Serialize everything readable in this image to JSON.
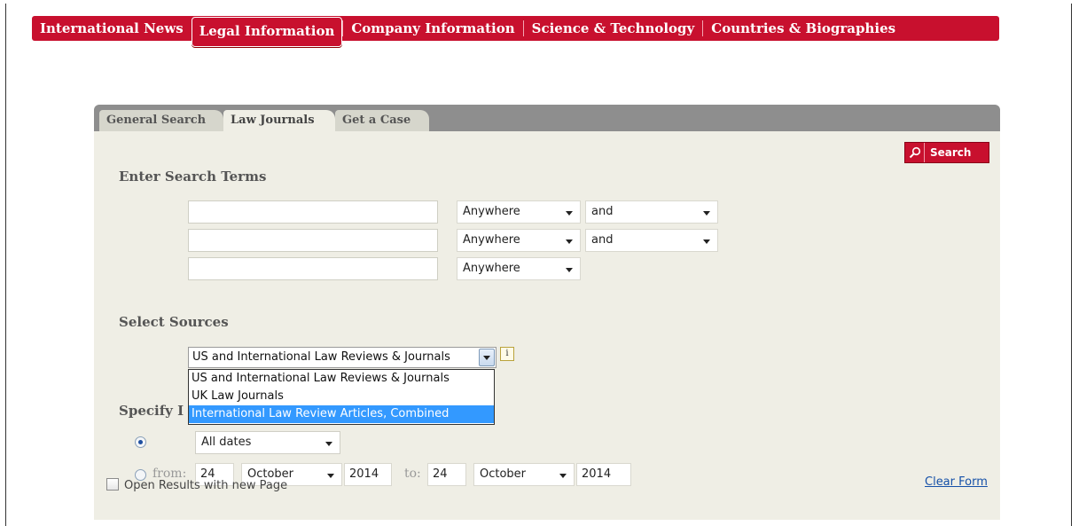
{
  "topnav": {
    "items": [
      "International News",
      "Legal Information",
      "Company Information",
      "Science & Technology",
      "Countries & Biographies"
    ],
    "active_index": 1
  },
  "tabs": [
    "General Search",
    "Law Journals",
    "Get a Case"
  ],
  "active_tab": "Law Journals",
  "search_button": "Search",
  "enter_terms": {
    "title": "Enter Search Terms",
    "rows": [
      {
        "value": "",
        "location": "Anywhere",
        "connector": "and"
      },
      {
        "value": "",
        "location": "Anywhere",
        "connector": "and"
      },
      {
        "value": "",
        "location": "Anywhere"
      }
    ]
  },
  "sources": {
    "title": "Select Sources",
    "selected": "US and International Law Reviews & Journals",
    "info_icon": "i",
    "options": [
      "US and International Law Reviews & Journals",
      "UK Law Journals",
      "International Law Review Articles, Combined"
    ],
    "highlighted_index": 2
  },
  "dates": {
    "title_visible": "Specify I",
    "all_dates": "All dates",
    "from_label": "from:",
    "to_label": "to:",
    "from": {
      "day": "24",
      "month": "October",
      "year": "2014"
    },
    "to": {
      "day": "24",
      "month": "October",
      "year": "2014"
    }
  },
  "options": {
    "open_results_label": "Open Results with new Page",
    "clear_form": "Clear Form"
  },
  "colors": {
    "brand_red": "#c8102e",
    "panel_bg": "#efeee5",
    "tabbar_gray": "#8e8e8e",
    "highlight_blue": "#3399ff",
    "link_blue": "#1550a8"
  }
}
